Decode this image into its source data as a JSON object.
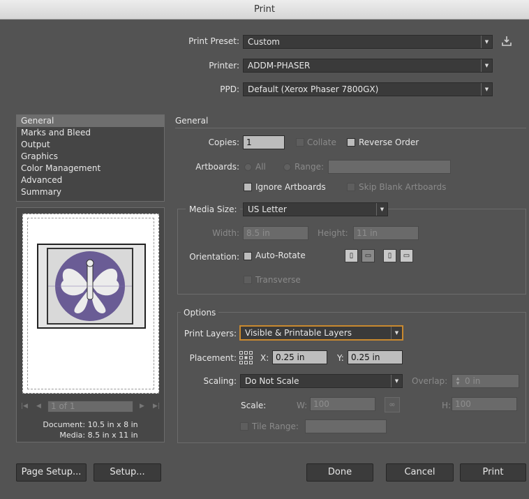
{
  "window": {
    "title": "Print"
  },
  "preset": {
    "label": "Print Preset:",
    "value": "Custom"
  },
  "printer": {
    "label": "Printer:",
    "value": "ADDM-PHASER"
  },
  "ppd": {
    "label": "PPD:",
    "value": "Default (Xerox Phaser 7800GX)"
  },
  "sidebar": {
    "items": [
      {
        "label": "General",
        "selected": true
      },
      {
        "label": "Marks and Bleed"
      },
      {
        "label": "Output"
      },
      {
        "label": "Graphics"
      },
      {
        "label": "Color Management"
      },
      {
        "label": "Advanced"
      },
      {
        "label": "Summary"
      }
    ]
  },
  "preview": {
    "pager": "1 of 1",
    "document_info": "Document: 10.5 in x 8 in",
    "media_info": "Media: 8.5 in x 11 in"
  },
  "general": {
    "heading": "General",
    "copies_label": "Copies:",
    "copies_value": "1",
    "collate_label": "Collate",
    "reverse_label": "Reverse Order",
    "artboards_label": "Artboards:",
    "all_label": "All",
    "range_label": "Range:",
    "ignore_label": "Ignore Artboards",
    "skip_label": "Skip Blank Artboards"
  },
  "media": {
    "label": "Media Size:",
    "value": "US Letter",
    "width_label": "Width:",
    "width_value": "8.5 in",
    "height_label": "Height:",
    "height_value": "11 in",
    "orientation_label": "Orientation:",
    "autorotate_label": "Auto-Rotate",
    "transverse_label": "Transverse"
  },
  "options": {
    "heading": "Options",
    "layers_label": "Print Layers:",
    "layers_value": "Visible & Printable Layers",
    "placement_label": "Placement:",
    "x_label": "X:",
    "x_value": "0.25 in",
    "y_label": "Y:",
    "y_value": "0.25 in",
    "scaling_label": "Scaling:",
    "scaling_value": "Do Not Scale",
    "overlap_label": "Overlap:",
    "overlap_value": "0 in",
    "scale_label": "Scale:",
    "w_label": "W:",
    "w_value": "100",
    "h_label": "H:",
    "h_value": "100",
    "tile_label": "Tile Range:"
  },
  "buttons": {
    "page_setup": "Page Setup...",
    "setup": "Setup...",
    "done": "Done",
    "cancel": "Cancel",
    "print": "Print"
  },
  "colors": {
    "accent_outline": "#c9892f",
    "artwork_purple": "#6a5c95"
  }
}
